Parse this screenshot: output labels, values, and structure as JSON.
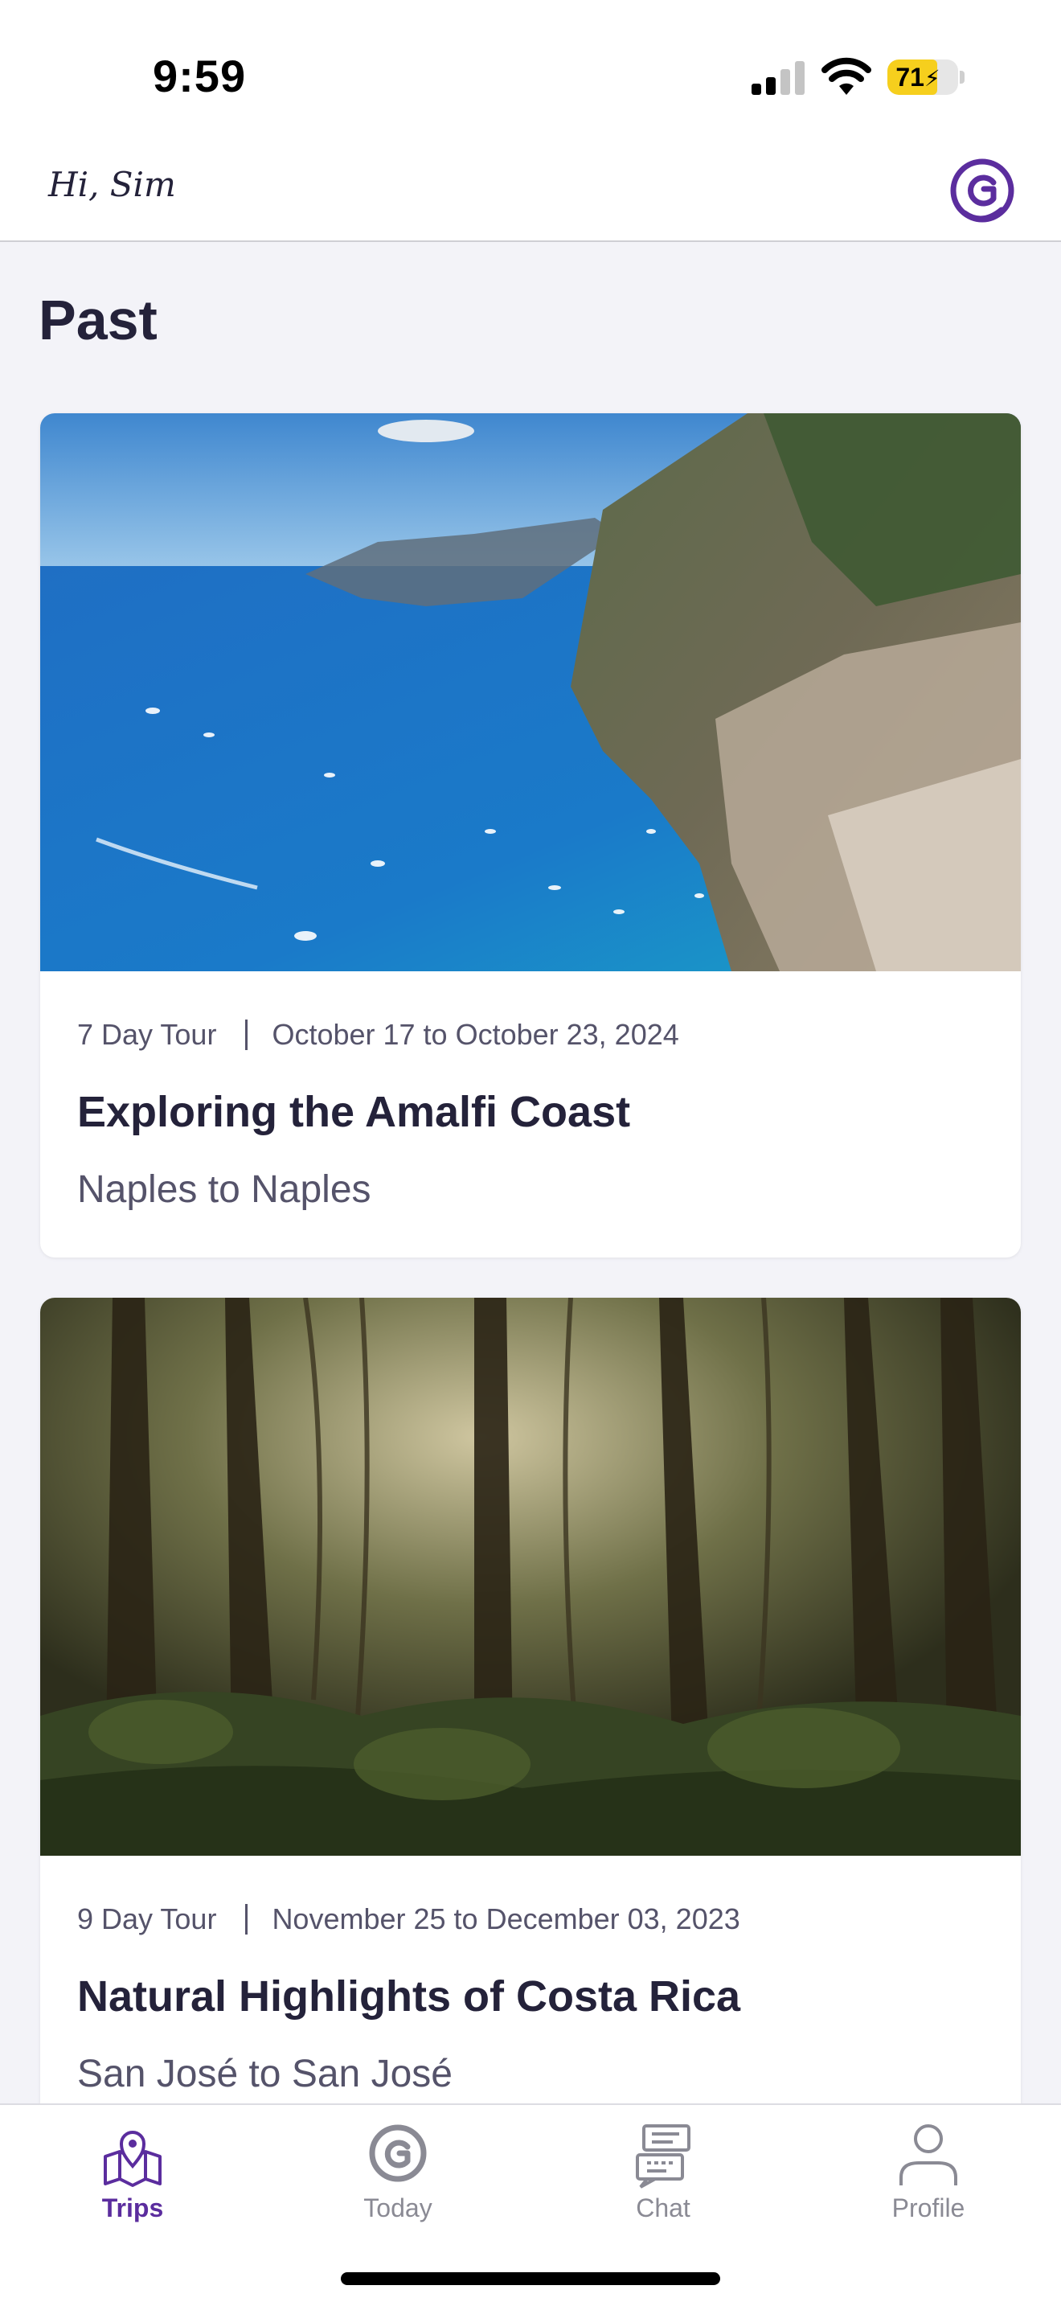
{
  "status_bar": {
    "time": "9:59",
    "battery_percent": "71",
    "battery_level": 0.71,
    "battery_color": "#f6cf1d",
    "signal_bars_active": 2,
    "signal_bars_total": 4
  },
  "header": {
    "greeting": "Hi, Sim",
    "logo_icon": "g-circle-brand-icon"
  },
  "main": {
    "section_title": "Past",
    "trips": [
      {
        "duration": "7 Day Tour",
        "dates": "October 17 to October 23, 2024",
        "title": "Exploring the Amalfi Coast",
        "route": "Naples to Naples",
        "image": "coastal-cliffs-sea-photo"
      },
      {
        "duration": "9 Day Tour",
        "dates": "November 25 to December 03, 2023",
        "title": "Natural Highlights of Costa Rica",
        "route": "San José to San José",
        "image": "rainforest-photo"
      }
    ]
  },
  "tab_bar": {
    "active": "Trips",
    "accent_color": "#5b2d9e",
    "inactive_color": "#8a8a94",
    "tabs": [
      {
        "label": "Trips",
        "icon": "map-pin-icon"
      },
      {
        "label": "Today",
        "icon": "g-logo-icon"
      },
      {
        "label": "Chat",
        "icon": "chat-icon"
      },
      {
        "label": "Profile",
        "icon": "person-icon"
      }
    ]
  }
}
